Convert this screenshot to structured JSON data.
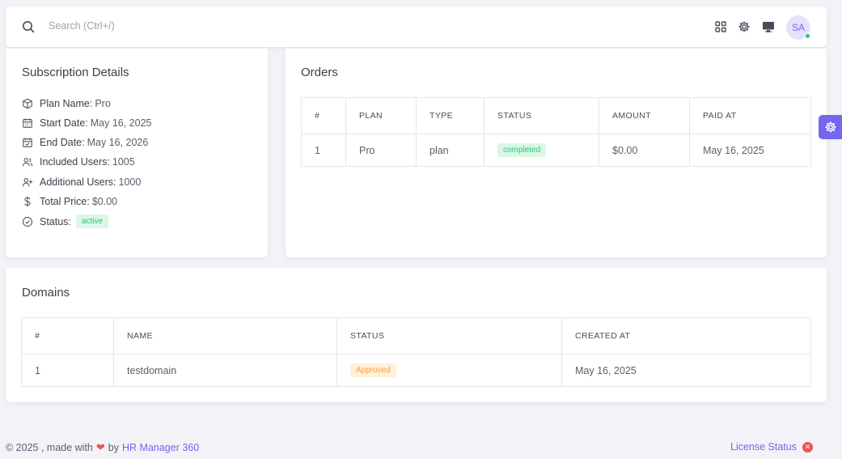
{
  "header": {
    "search_placeholder": "Search (Ctrl+/)",
    "avatar_initials": "SA"
  },
  "subscription": {
    "title": "Subscription Details",
    "plan_name_label": "Plan Name:",
    "plan_name": "Pro",
    "start_date_label": "Start Date:",
    "start_date": "May 16, 2025",
    "end_date_label": "End Date:",
    "end_date": "May 16, 2026",
    "included_users_label": "Included Users:",
    "included_users": "1005",
    "additional_users_label": "Additional Users:",
    "additional_users": "1000",
    "total_price_label": "Total Price:",
    "total_price": "$0.00",
    "status_label": "Status:",
    "status": "active"
  },
  "orders": {
    "title": "Orders",
    "columns": [
      "#",
      "PLAN",
      "TYPE",
      "STATUS",
      "AMOUNT",
      "PAID AT"
    ],
    "rows": [
      {
        "num": "1",
        "plan": "Pro",
        "type": "plan",
        "status": "completed",
        "amount": "$0.00",
        "paid_at": "May 16, 2025"
      }
    ]
  },
  "domains": {
    "title": "Domains",
    "columns": [
      "#",
      "NAME",
      "STATUS",
      "CREATED AT"
    ],
    "rows": [
      {
        "num": "1",
        "name": "testdomain",
        "status": "Approved",
        "created_at": "May 16, 2025"
      }
    ]
  },
  "footer": {
    "copyright": "© 2025 , made with",
    "by": "by",
    "brand": "HR Manager 360",
    "license_status": "License Status"
  },
  "colors": {
    "primary": "#7367f0",
    "success": "#28c76f",
    "warning": "#ff9f43",
    "danger": "#ea5455"
  }
}
